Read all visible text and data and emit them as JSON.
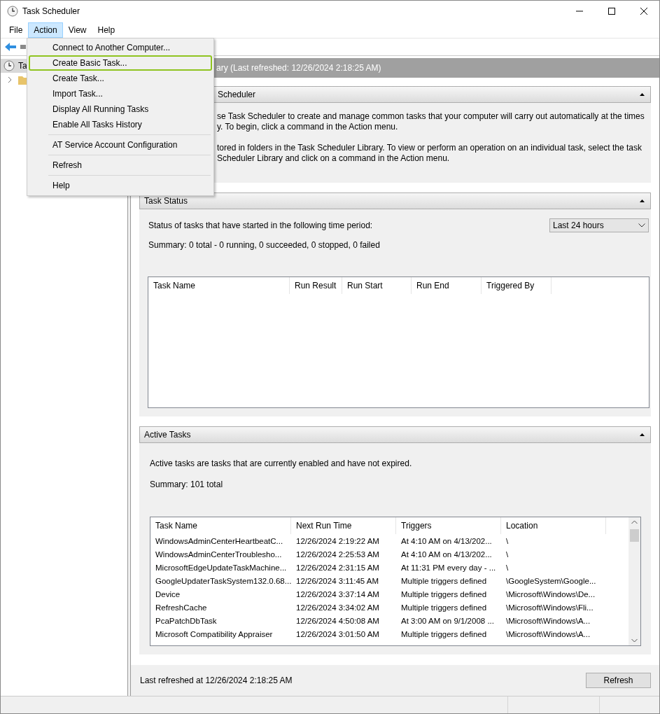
{
  "window": {
    "title": "Task Scheduler"
  },
  "menu_bar": [
    {
      "label": "File",
      "selected": false
    },
    {
      "label": "Action",
      "selected": true
    },
    {
      "label": "View",
      "selected": false
    },
    {
      "label": "Help",
      "selected": false
    }
  ],
  "action_menu": [
    {
      "kind": "item",
      "label": "Connect to Another Computer...",
      "selected": false
    },
    {
      "kind": "item",
      "label": "Create Basic Task...",
      "selected": true
    },
    {
      "kind": "item",
      "label": "Create Task...",
      "selected": false
    },
    {
      "kind": "item",
      "label": "Import Task...",
      "selected": false
    },
    {
      "kind": "item",
      "label": "Display All Running Tasks",
      "selected": false
    },
    {
      "kind": "item",
      "label": "Enable All Tasks History",
      "selected": false
    },
    {
      "kind": "separator"
    },
    {
      "kind": "item",
      "label": "AT Service Account Configuration",
      "selected": false
    },
    {
      "kind": "separator"
    },
    {
      "kind": "item",
      "label": "Refresh",
      "selected": false
    },
    {
      "kind": "separator"
    },
    {
      "kind": "item",
      "label": "Help",
      "selected": false
    }
  ],
  "tree": [
    {
      "label": "Ta",
      "selected": true,
      "children": [
        {
          "expanded": false
        }
      ]
    }
  ],
  "summary_header": "ary (Last refreshed: 12/26/2024 2:18:25 AM)",
  "overview": {
    "title": "Scheduler",
    "expanded": true,
    "paragraphs": [
      [
        "se Task Scheduler to create and manage common tasks that your computer will carry out automatically at the times",
        "y. To begin, click a command in the Action menu."
      ],
      [
        "tored in folders in the Task Scheduler Library. To view or perform an operation on an individual task, select the task",
        "Scheduler Library and click on a command in the Action menu."
      ]
    ]
  },
  "task_status": {
    "title": "Task Status",
    "expanded": true,
    "prompt": "Status of tasks that have started in the following time period:",
    "period": "Last 24 hours",
    "summary": "Summary: 0 total - 0 running, 0 succeeded, 0 stopped, 0 failed",
    "columns": [
      "Task Name",
      "Run Result",
      "Run Start",
      "Run End",
      "Triggered By"
    ]
  },
  "active_tasks": {
    "title": "Active Tasks",
    "expanded": true,
    "description": "Active tasks are tasks that are currently enabled and have not expired.",
    "summary": "Summary: 101 total",
    "columns": [
      "Task Name",
      "Next Run Time",
      "Triggers",
      "Location"
    ],
    "rows": [
      [
        "WindowsAdminCenterHeartbeatC...",
        "12/26/2024 2:19:22 AM",
        "At 4:10 AM on 4/13/202...",
        "\\"
      ],
      [
        "WindowsAdminCenterTroublesho...",
        "12/26/2024 2:25:53 AM",
        "At 4:10 AM on 4/13/202...",
        "\\"
      ],
      [
        "MicrosoftEdgeUpdateTaskMachine...",
        "12/26/2024 2:31:15 AM",
        "At 11:31 PM every day - ...",
        "\\"
      ],
      [
        "GoogleUpdaterTaskSystem132.0.68...",
        "12/26/2024 3:11:45 AM",
        "Multiple triggers defined",
        "\\GoogleSystem\\Google..."
      ],
      [
        "Device",
        "12/26/2024 3:37:14 AM",
        "Multiple triggers defined",
        "\\Microsoft\\Windows\\De..."
      ],
      [
        "RefreshCache",
        "12/26/2024 3:34:02 AM",
        "Multiple triggers defined",
        "\\Microsoft\\Windows\\Fli..."
      ],
      [
        "PcaPatchDbTask",
        "12/26/2024 4:50:08 AM",
        "At 3:00 AM on 9/1/2008 ...",
        "\\Microsoft\\Windows\\A..."
      ],
      [
        "Microsoft Compatibility Appraiser",
        "12/26/2024 3:01:50 AM",
        "Multiple triggers defined",
        "\\Microsoft\\Windows\\A..."
      ]
    ]
  },
  "footer": {
    "last_refreshed": "Last refreshed at 12/26/2024 2:18:25 AM",
    "button": "Refresh"
  }
}
